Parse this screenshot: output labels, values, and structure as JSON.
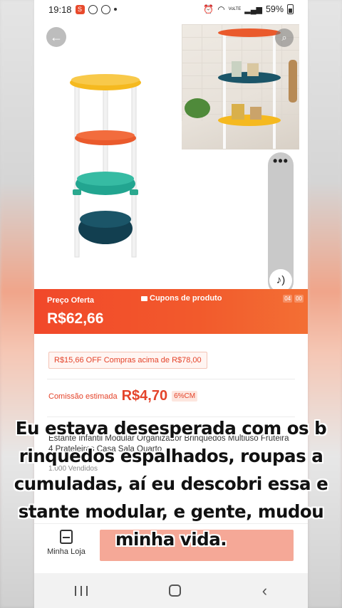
{
  "status_bar": {
    "time": "19:18",
    "battery": "59%",
    "net_label": "VoLTE"
  },
  "product": {
    "back_icon": "arrow-left-icon",
    "search_icon": "search-icon",
    "more_icon": "more-dots-icon",
    "sound_icon": "speaker-icon"
  },
  "price_bar": {
    "label": "Preço Oferta",
    "price": "R$62,66",
    "coupon_label": "Cupons de produto",
    "timer": [
      "04",
      "00"
    ]
  },
  "promo": {
    "text": "R$15,66 OFF Compras acima de R$78,00"
  },
  "commission": {
    "label": "Comissão estimada",
    "value": "R$4,70",
    "badge": "6%CM"
  },
  "title": {
    "text": "Estante Infantil Modular Organizador Brinquedos Multiuso Fruteira 4 Prateleiras Casa Sala Quarto"
  },
  "sold": {
    "text": "1.000 Vendidos"
  },
  "bottom_bar": {
    "store_label": "Minha Loja"
  },
  "caption": {
    "lines": [
      "Eu estava desesperada com os b",
      "rinquedos espalhados, roupas a",
      "cumuladas, aí eu descobri essa e",
      "stante modular, e gente, mudou",
      "minha vida."
    ]
  },
  "colors": {
    "accent": "#f1482a",
    "price_text": "#e4432a"
  }
}
